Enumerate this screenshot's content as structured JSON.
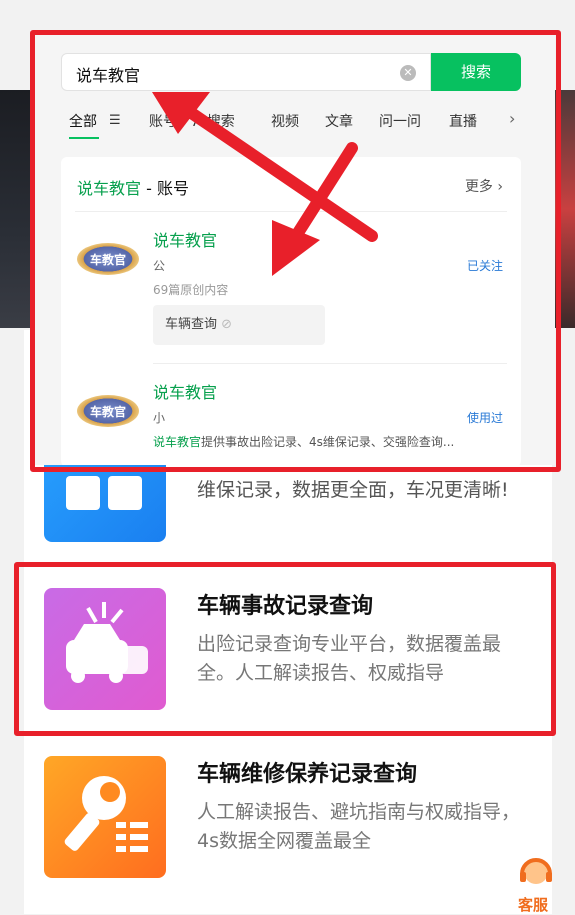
{
  "search": {
    "query": "说车教官",
    "button_label": "搜索"
  },
  "tabs": [
    {
      "label": "全部"
    },
    {
      "label": "账号"
    },
    {
      "label": "AI搜索"
    },
    {
      "label": "视频"
    },
    {
      "label": "文章"
    },
    {
      "label": "问一问"
    },
    {
      "label": "直播"
    }
  ],
  "results": {
    "heading_name": "说车教官",
    "heading_suffix": " - 账号",
    "more_label": "更多",
    "accounts": [
      {
        "logo_text": "车教官",
        "name": "说车教官",
        "type": "公",
        "meta": "69篇原创内容",
        "status": "已关注",
        "chip": "车辆查询"
      },
      {
        "logo_text": "车教官",
        "name": "说车教官",
        "type": "小",
        "status": "使用过",
        "snippet_highlight": "说车教官",
        "snippet_rest": "提供事故出险记录、4s维保记录、交强险查询..."
      }
    ]
  },
  "background": {
    "partial_desc": "维保记录，数据更全面，车况更清晰!"
  },
  "services": [
    {
      "title": "车辆事故记录查询",
      "desc": "出险记录查询专业平台，数据覆盖最全。人工解读报告、权威指导",
      "icon": "car-accident-icon",
      "color_from": "#c86be6",
      "color_to": "#e05bd0"
    },
    {
      "title": "车辆维修保养记录查询",
      "desc": "人工解读报告、避坑指南与权威指导，4s数据全网覆盖最全",
      "icon": "wrench-icon",
      "color_from": "#ffa726",
      "color_to": "#ff6d1f"
    }
  ],
  "customer_service": {
    "label": "客服",
    "icon": "headset-icon"
  },
  "colors": {
    "accent_green": "#07c160",
    "annotation_red": "#e8202a"
  }
}
